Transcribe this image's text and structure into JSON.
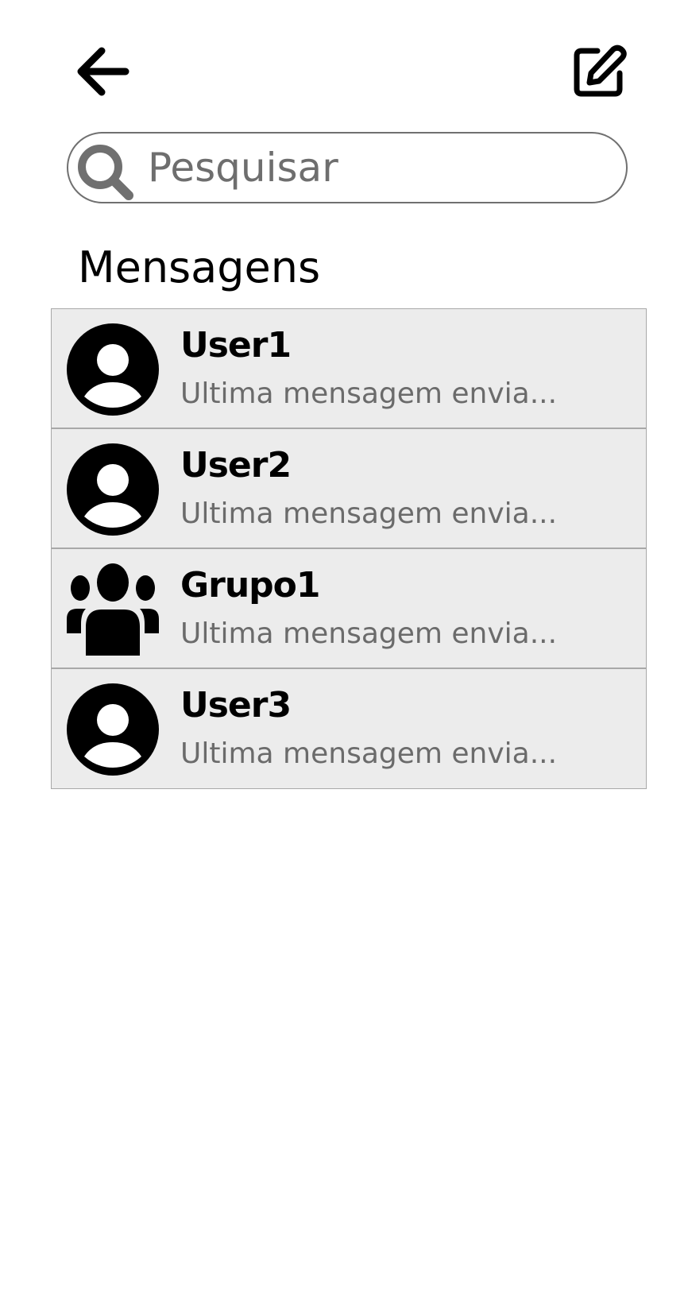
{
  "header": {
    "back_icon": "arrow-left-icon",
    "compose_icon": "edit-pencil-icon"
  },
  "search": {
    "placeholder": "Pesquisar",
    "value": "",
    "icon": "search-icon"
  },
  "section_title": "Mensagens",
  "conversations": [
    {
      "name": "User1",
      "preview": "Ultima mensagem envia...",
      "avatar": "user-avatar-icon"
    },
    {
      "name": "User2",
      "preview": "Ultima mensagem envia...",
      "avatar": "user-avatar-icon"
    },
    {
      "name": "Grupo1",
      "preview": "Ultima mensagem envia...",
      "avatar": "group-icon"
    },
    {
      "name": "User3",
      "preview": "Ultima mensagem envia...",
      "avatar": "user-avatar-icon"
    }
  ],
  "colors": {
    "list_background": "#ececec",
    "divider": "#a8a8a8",
    "secondary_text": "#6b6b6b"
  }
}
